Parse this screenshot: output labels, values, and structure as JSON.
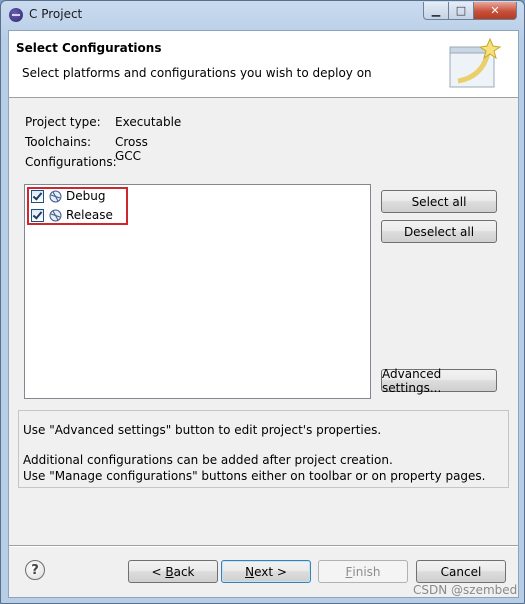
{
  "window": {
    "title": "C Project"
  },
  "header": {
    "title": "Select Configurations",
    "description": "Select platforms and configurations you wish to deploy on"
  },
  "info": {
    "project_type_label": "Project type:",
    "project_type_value": "Executable",
    "toolchains_label": "Toolchains:",
    "toolchains_value": "Cross GCC",
    "configurations_label": "Configurations:"
  },
  "configurations": [
    {
      "label": "Debug",
      "checked": true
    },
    {
      "label": "Release",
      "checked": true
    }
  ],
  "side_buttons": {
    "select_all": "Select all",
    "deselect_all": "Deselect all",
    "advanced_settings": "Advanced settings..."
  },
  "help_text": {
    "line1": "Use \"Advanced settings\" button to edit project's properties.",
    "line2": "Additional configurations can be added after project creation.",
    "line3": "Use \"Manage configurations\" buttons either on toolbar or on property pages."
  },
  "footer": {
    "help_icon": "?",
    "back_prefix": "< ",
    "back_mnemonic": "B",
    "back_rest": "ack",
    "next_mnemonic": "N",
    "next_rest": "ext >",
    "finish_mnemonic": "F",
    "finish_rest": "inish",
    "cancel": "Cancel"
  },
  "watermark": "CSDN @szembed",
  "colors": {
    "highlight_box": "#d0262d",
    "default_button_border": "#3c7fb1"
  },
  "icons": [
    "c-project-icon",
    "minimize-icon",
    "maximize-icon",
    "close-icon",
    "wizard-banner-icon",
    "configuration-icon",
    "help-icon"
  ]
}
